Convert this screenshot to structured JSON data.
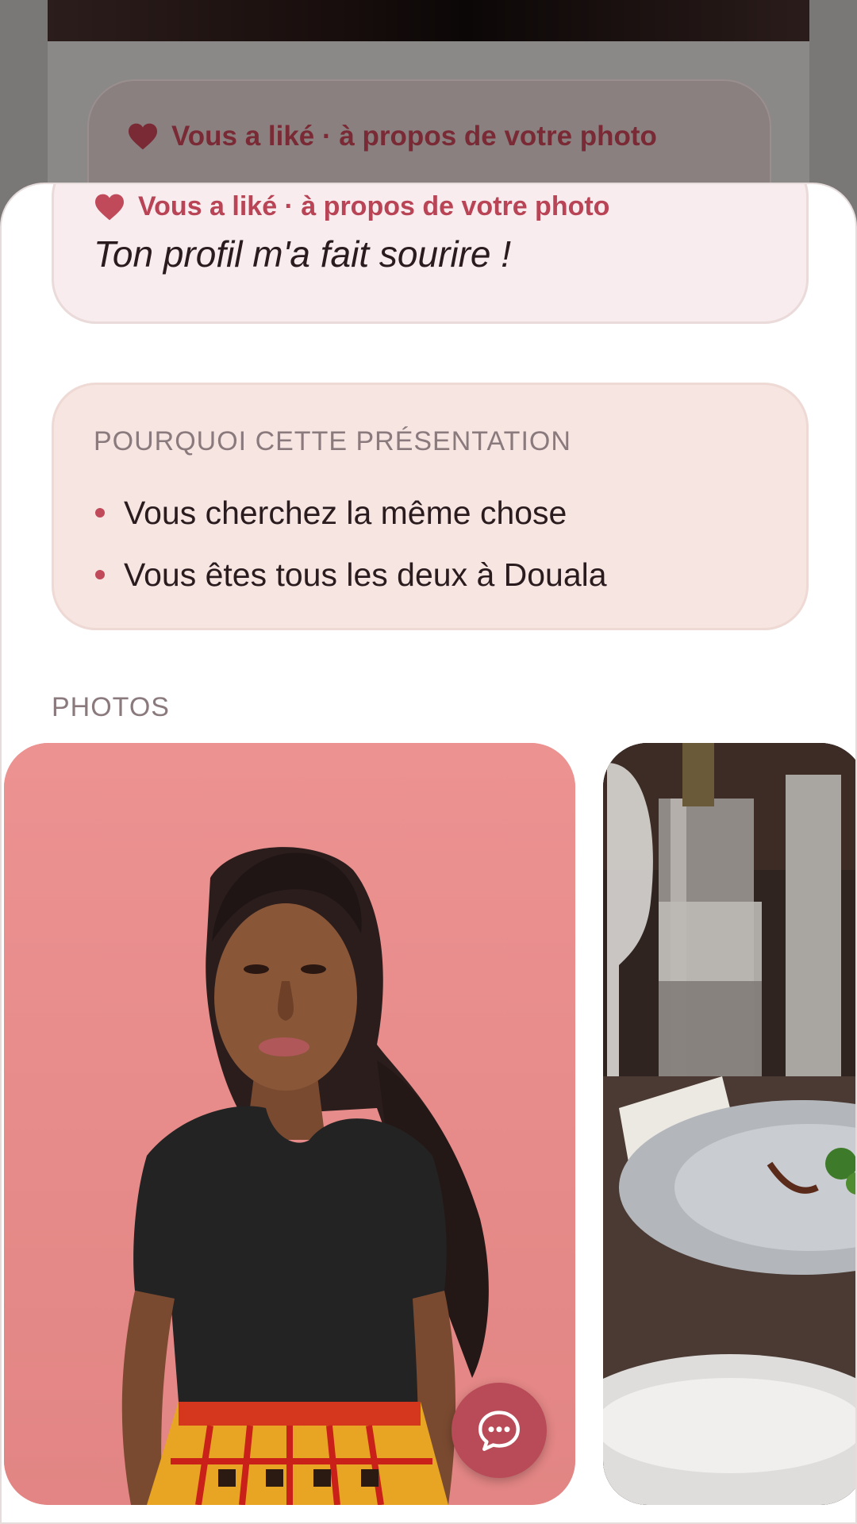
{
  "background_screen": {
    "liked_line": "Vous a liké · à propos de votre photo"
  },
  "comment": {
    "header": "Vous a liké · à propos de votre photo",
    "text": "Ton profil m'a fait sourire !"
  },
  "reasons": {
    "title": "POURQUOI CETTE PRÉSENTATION",
    "items": [
      "Vous cherchez la même chose",
      "Vous êtes tous les deux à Douala"
    ]
  },
  "photos": {
    "label": "PHOTOS",
    "items": [
      {
        "icon": "portrait-photo"
      },
      {
        "icon": "restaurant-table-photo"
      }
    ]
  },
  "fab": {
    "icon": "chat-bubble-icon"
  },
  "colors": {
    "accent": "#b94a57",
    "heart": "#c04a5a",
    "comment_bg": "#f8ecef",
    "reason_bg": "#f6e5e1"
  }
}
